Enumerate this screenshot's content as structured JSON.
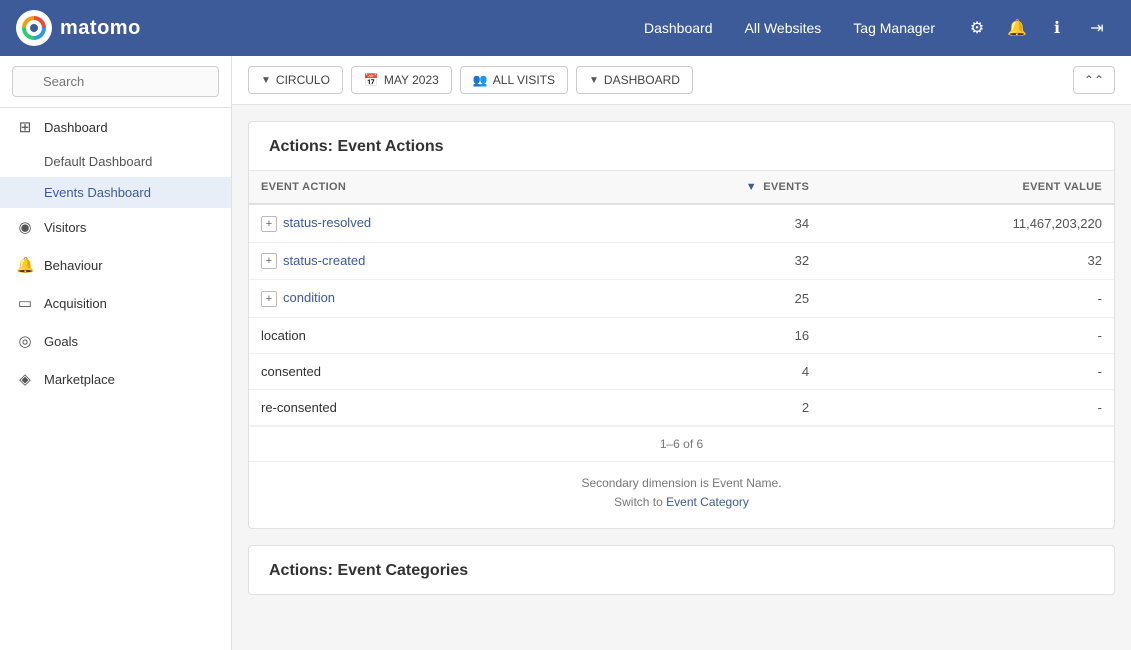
{
  "app": {
    "logo_text": "matomo",
    "nav_links": [
      {
        "label": "Dashboard",
        "id": "nav-dashboard"
      },
      {
        "label": "All Websites",
        "id": "nav-all-websites"
      },
      {
        "label": "Tag Manager",
        "id": "nav-tag-manager"
      }
    ],
    "nav_icons": [
      {
        "name": "gear-icon",
        "symbol": "⚙"
      },
      {
        "name": "bell-icon",
        "symbol": "🔔"
      },
      {
        "name": "info-icon",
        "symbol": "ℹ"
      },
      {
        "name": "signout-icon",
        "symbol": "⎋"
      }
    ]
  },
  "sidebar": {
    "search_placeholder": "Search",
    "items": [
      {
        "label": "Dashboard",
        "icon": "▦",
        "id": "sidebar-dashboard",
        "children": [
          {
            "label": "Default Dashboard",
            "id": "sidebar-default-dashboard"
          },
          {
            "label": "Events Dashboard",
            "id": "sidebar-events-dashboard",
            "active": true
          }
        ]
      },
      {
        "label": "Visitors",
        "icon": "◉",
        "id": "sidebar-visitors"
      },
      {
        "label": "Behaviour",
        "icon": "🔔",
        "id": "sidebar-behaviour"
      },
      {
        "label": "Acquisition",
        "icon": "▭",
        "id": "sidebar-acquisition"
      },
      {
        "label": "Goals",
        "icon": "◎",
        "id": "sidebar-goals"
      },
      {
        "label": "Marketplace",
        "icon": "◈",
        "id": "sidebar-marketplace"
      }
    ]
  },
  "toolbar": {
    "site_btn": "CIRCULO",
    "date_btn": "MAY 2023",
    "segment_btn": "ALL VISITS",
    "view_btn": "DASHBOARD",
    "collapse_icon": "⌃"
  },
  "event_actions_table": {
    "title": "Actions: Event Actions",
    "columns": [
      {
        "label": "EVENT ACTION",
        "align": "left",
        "id": "col-event-action"
      },
      {
        "label": "EVENTS",
        "align": "right",
        "sort": true,
        "id": "col-events"
      },
      {
        "label": "EVENT VALUE",
        "align": "right",
        "id": "col-event-value"
      }
    ],
    "rows": [
      {
        "action": "status-resolved",
        "expandable": true,
        "events": "34",
        "value": "11,467,203,220"
      },
      {
        "action": "status-created",
        "expandable": true,
        "events": "32",
        "value": "32"
      },
      {
        "action": "condition",
        "expandable": true,
        "events": "25",
        "value": "-"
      },
      {
        "action": "location",
        "expandable": false,
        "events": "16",
        "value": "-"
      },
      {
        "action": "consented",
        "expandable": false,
        "events": "4",
        "value": "-"
      },
      {
        "action": "re-consented",
        "expandable": false,
        "events": "2",
        "value": "-"
      }
    ],
    "pagination": "1–6 of 6",
    "note_line1": "Secondary dimension is Event Name.",
    "note_line2_prefix": "Switch to ",
    "note_link": "Event Category"
  },
  "event_categories_table": {
    "title": "Actions: Event Categories"
  }
}
